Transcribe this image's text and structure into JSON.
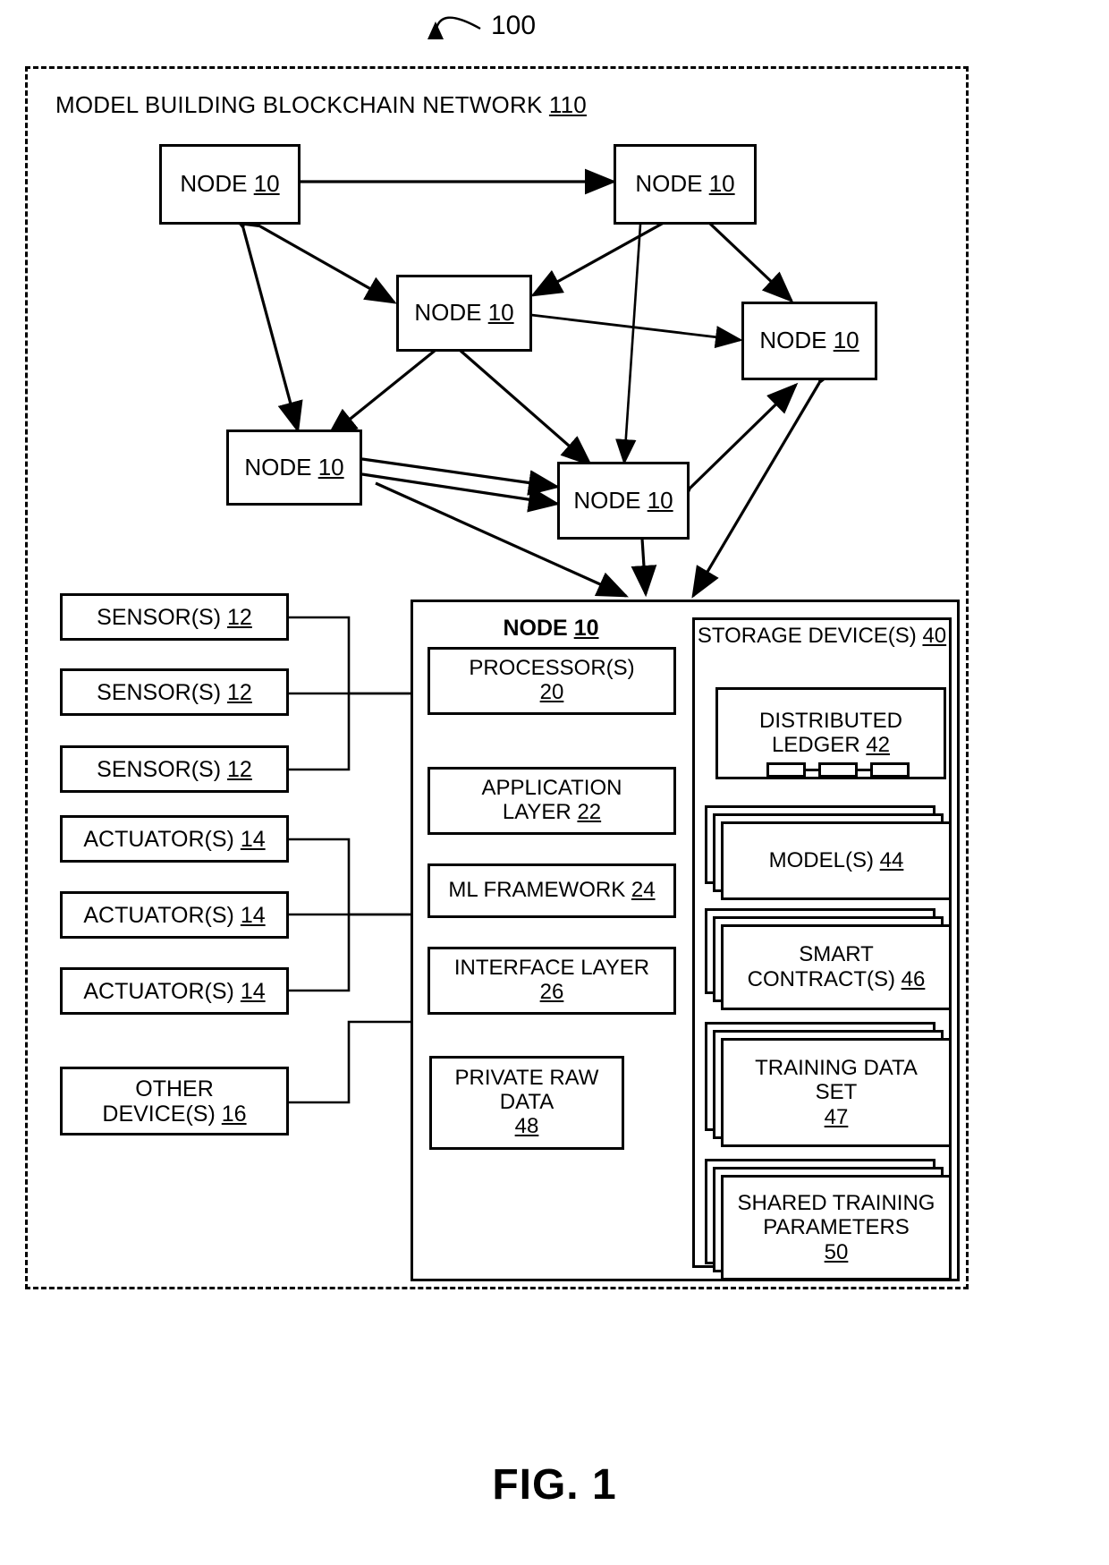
{
  "figure": {
    "caption": "FIG. 1",
    "reference_numeral": "100"
  },
  "network": {
    "title_text": "MODEL BUILDING BLOCKCHAIN NETWORK ",
    "title_numeral": "110"
  },
  "mesh_nodes": [
    {
      "label": "NODE ",
      "numeral": "10"
    },
    {
      "label": "NODE ",
      "numeral": "10"
    },
    {
      "label": "NODE ",
      "numeral": "10"
    },
    {
      "label": "NODE ",
      "numeral": "10"
    },
    {
      "label": "NODE ",
      "numeral": "10"
    },
    {
      "label": "NODE ",
      "numeral": "10"
    }
  ],
  "peripherals": [
    {
      "label": "SENSOR(S) ",
      "numeral": "12"
    },
    {
      "label": "SENSOR(S) ",
      "numeral": "12"
    },
    {
      "label": "SENSOR(S) ",
      "numeral": "12"
    },
    {
      "label": "ACTUATOR(S) ",
      "numeral": "14"
    },
    {
      "label": "ACTUATOR(S) ",
      "numeral": "14"
    },
    {
      "label": "ACTUATOR(S) ",
      "numeral": "14"
    },
    {
      "label": "OTHER\nDEVICE(S) ",
      "numeral": "16"
    }
  ],
  "node_detail": {
    "title_text": "NODE ",
    "title_numeral": "10",
    "components": [
      {
        "line1": "PROCESSOR(S)",
        "line2": "",
        "numeral": "20",
        "numeral_on_own_line": true
      },
      {
        "line1": "APPLICATION",
        "line2": "LAYER ",
        "numeral": "22",
        "numeral_on_own_line": false
      },
      {
        "line1": "ML FRAMEWORK ",
        "line2": "",
        "numeral": "24",
        "numeral_on_own_line": false
      },
      {
        "line1": "INTERFACE LAYER",
        "line2": "",
        "numeral": "26",
        "numeral_on_own_line": true
      },
      {
        "line1": "PRIVATE RAW",
        "line2": "DATA",
        "numeral": "48",
        "numeral_on_own_line": true
      }
    ]
  },
  "storage": {
    "title_line1": "STORAGE",
    "title_line2": "DEVICE(S) ",
    "title_numeral": "40",
    "items": [
      {
        "line1": "DISTRIBUTED",
        "line2": "LEDGER ",
        "numeral": "42",
        "numeral_on_own_line": false,
        "stacked": false,
        "has_chain": true
      },
      {
        "line1": "MODEL(S) ",
        "line2": "",
        "numeral": "44",
        "numeral_on_own_line": false,
        "stacked": true,
        "has_chain": false
      },
      {
        "line1": "SMART",
        "line2": "CONTRACT(S) ",
        "numeral": "46",
        "numeral_on_own_line": false,
        "stacked": true,
        "has_chain": false
      },
      {
        "line1": "TRAINING DATA",
        "line2": "SET",
        "numeral": "47",
        "numeral_on_own_line": true,
        "stacked": true,
        "has_chain": false
      },
      {
        "line1": "SHARED TRAINING",
        "line2": "PARAMETERS",
        "numeral": "50",
        "numeral_on_own_line": true,
        "stacked": true,
        "has_chain": false
      }
    ]
  },
  "ledger_chain": {
    "block_count": 3,
    "icon": "blockchain-link-icon"
  },
  "colors": {
    "stroke": "#000000",
    "background": "#ffffff"
  }
}
